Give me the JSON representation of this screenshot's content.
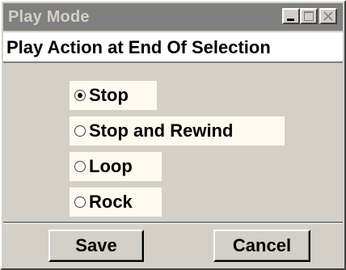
{
  "window": {
    "title": "Play Mode"
  },
  "header": {
    "label": "Play Action at End Of Selection"
  },
  "options": [
    {
      "label": "Stop",
      "checked": true
    },
    {
      "label": "Stop and Rewind",
      "checked": false
    },
    {
      "label": "Loop",
      "checked": false
    },
    {
      "label": "Rock",
      "checked": false
    }
  ],
  "buttons": {
    "save_label": "Save",
    "cancel_label": "Cancel"
  },
  "colors": {
    "titlebar": "#808080",
    "window_face": "#d4d0c8",
    "option_background": "#fffaf0"
  },
  "icons": {
    "minimize": "minimize-icon",
    "maximize": "maximize-icon",
    "close": "close-icon",
    "radio_selected": "radio-selected-icon",
    "radio_unselected": "radio-unselected-icon"
  }
}
